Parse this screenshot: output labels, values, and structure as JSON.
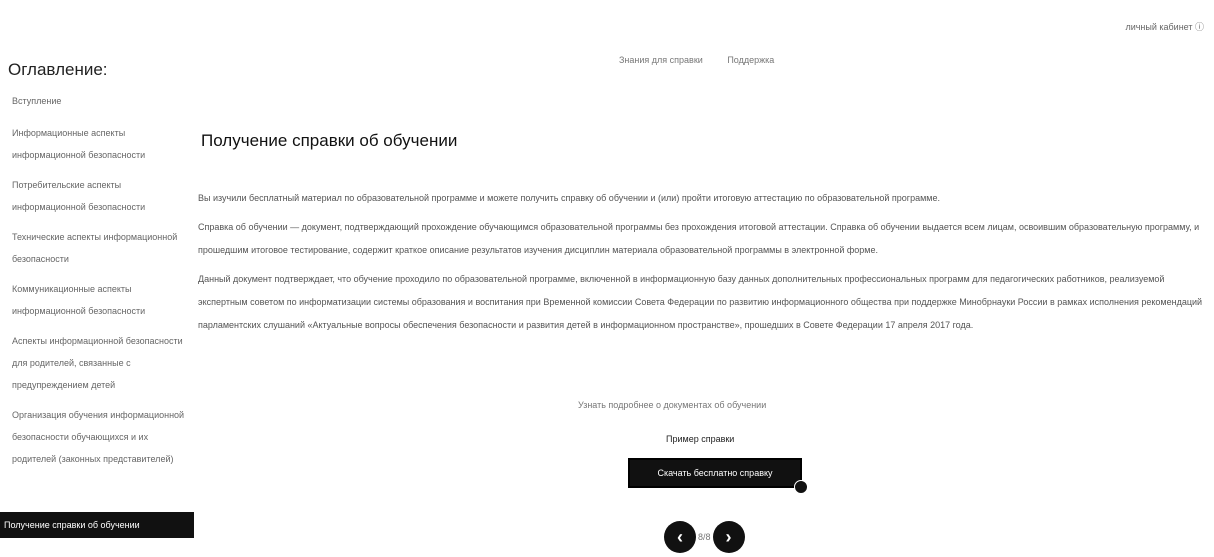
{
  "header": {
    "user_menu": "личный кабинет ⓘ"
  },
  "toc": {
    "title": "Оглавление:",
    "items": [
      {
        "label": "Вступление"
      },
      {
        "label": "Информационные аспекты информационной безопасности"
      },
      {
        "label": "Потребительские аспекты информационной безопасности"
      },
      {
        "label": "Технические аспекты информационной безопасности"
      },
      {
        "label": "Коммуникационные аспекты информационной безопасности"
      },
      {
        "label": "Аспекты информационной безопасности для родителей, связанные с предупреждением детей"
      },
      {
        "label": "Организация обучения информационной безопасности обучающихся и их родителей (законных представителей)"
      },
      {
        "label": "Получение справки об обучении"
      }
    ]
  },
  "top_links": {
    "info": "Знания для справки",
    "support": "Поддержка"
  },
  "main": {
    "title": "Получение справки об обучении",
    "paragraphs": [
      "Вы изучили бесплатный материал по образовательной программе и можете получить справку об обучении и (или) пройти итоговую аттестацию по образовательной программе.",
      "Справка об обучении — документ, подтверждающий прохождение обучающимся образовательной программы без прохождения итоговой аттестации. Справка об обучении выдается всем лицам, освоившим образовательную программу, и прошедшим итоговое тестирование, содержит краткое описание результатов изучения дисциплин материала образовательной программы в электронной форме.",
      "Данный документ подтверждает, что обучение проходило по образовательной программе, включенной в информационную базу данных дополнительных профессиональных программ для педагогических работников, реализуемой экспертным советом по информатизации системы образования и воспитания при Временной комиссии Совета Федерации по развитию информационного общества при поддержке Минобрнауки России в рамках исполнения рекомендаций парламентских слушаний «Актуальные вопросы обеспечения безопасности и развития детей в информационном пространстве», прошедших в Совете Федерации 17 апреля 2017 года."
    ],
    "more_link": "Узнать подробнее о документах об обучении",
    "sample_label": "Пример справки",
    "download_button": "Скачать бесплатно справку"
  },
  "pager": {
    "prev_icon": "‹",
    "page": "8/8",
    "next_icon": "›"
  }
}
